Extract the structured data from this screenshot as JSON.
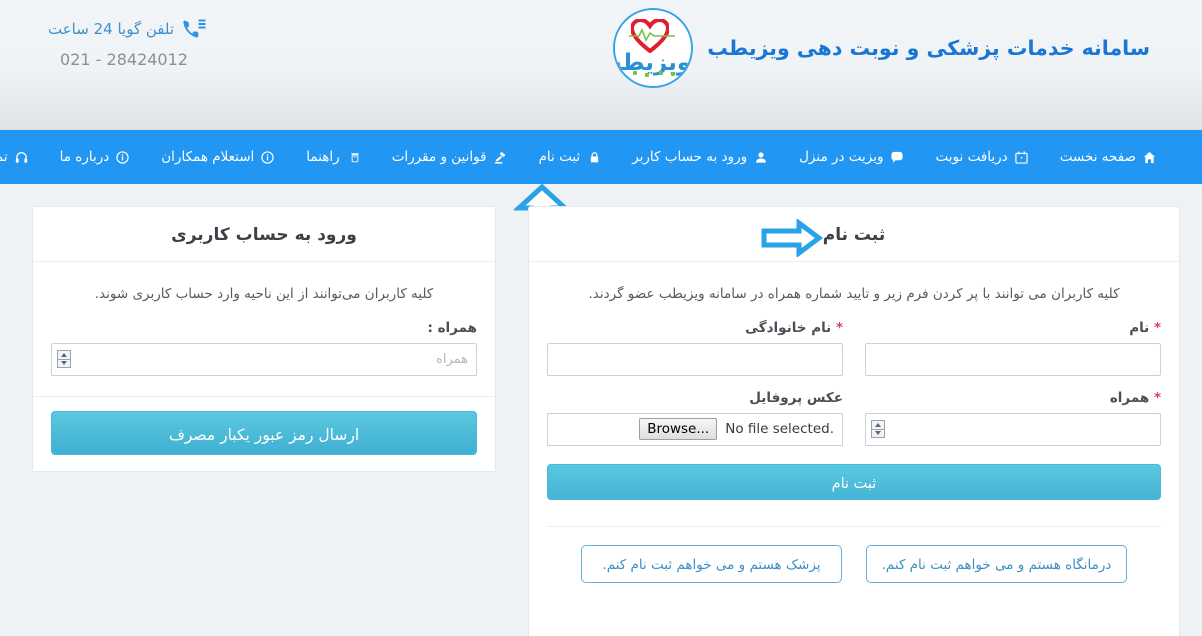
{
  "header": {
    "brand_title": "سامانه خدمات پزشکی و نوبت دهی ویزیطب",
    "logo_text": "ویزیطب",
    "contact_label": "تلفن گویا 24 ساعت",
    "contact_number": "021 - 28424012"
  },
  "nav": {
    "items": [
      {
        "label": "صفحه نخست",
        "icon": "home-icon"
      },
      {
        "label": "دریافت نوبت",
        "icon": "calendar-icon"
      },
      {
        "label": "ویزیت در منزل",
        "icon": "comment-icon"
      },
      {
        "label": "ورود به حساب کاربر",
        "icon": "user-icon"
      },
      {
        "label": "ثبت نام",
        "icon": "lock-icon"
      },
      {
        "label": "قوانین و مقررات",
        "icon": "gavel-icon"
      },
      {
        "label": "راهنما",
        "icon": "book-icon"
      },
      {
        "label": "استعلام همکاران",
        "icon": "info-circle-icon"
      },
      {
        "label": "درباره ما",
        "icon": "info-circle-icon"
      },
      {
        "label": "تماس با ما",
        "icon": "headset-icon"
      }
    ]
  },
  "register": {
    "title": "ثبت نام",
    "intro": "کلیه کاربران می توانند با پر کردن فرم زیر و تایید شماره همراه در سامانه ویزیطب عضو گردند.",
    "first_name_label": "نام",
    "first_name_value": "",
    "last_name_label": "نام خانوادگی",
    "last_name_value": "",
    "mobile_label": "همراه",
    "mobile_value": "",
    "profile_photo_label": "عکس پروفایل",
    "file_button": "Browse...",
    "file_status": "No file selected.",
    "required_mark": "*",
    "submit_label": "ثبت نام",
    "doctor_button": "پزشک هستم و می خواهم ثبت نام کنم.",
    "clinic_button": "درمانگاه هستم و می خواهم ثبت نام کنم."
  },
  "login": {
    "title": "ورود به حساب کاربری",
    "intro": "کلیه کاربران می‌توانند از این ناحیه وارد حساب کاربری شوند.",
    "mobile_label": "همراه :",
    "mobile_placeholder": "همراه",
    "mobile_value": "",
    "submit_label": "ارسال رمز عبور یکبار مصرف"
  },
  "annotations": {
    "arrow_up": "arrow-up-annotation",
    "arrow_right": "arrow-right-annotation"
  },
  "colors": {
    "nav_blue": "#2196f3",
    "brand_blue": "#1877d2",
    "button_cyan": "#43b4d4",
    "required_red": "#d9425f",
    "page_bg": "#eef2f5",
    "annotation_blue": "#29a3e8"
  }
}
